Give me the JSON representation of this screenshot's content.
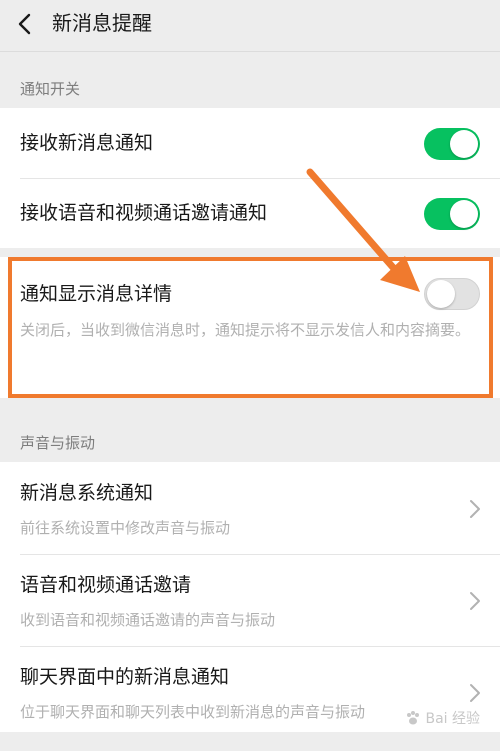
{
  "header": {
    "title": "新消息提醒",
    "back_icon": "chevron-left-icon"
  },
  "sections": {
    "notification_switches": {
      "label": "通知开关",
      "items": [
        {
          "title": "接收新消息通知",
          "toggle": "on"
        },
        {
          "title": "接收语音和视频通话邀请通知",
          "toggle": "on"
        },
        {
          "title": "通知显示消息详情",
          "toggle": "off",
          "description": "关闭后，当收到微信消息时，通知提示将不显示发信人和内容摘要。"
        }
      ]
    },
    "sound_vibration": {
      "label": "声音与振动",
      "items": [
        {
          "title": "新消息系统通知",
          "description": "前往系统设置中修改声音与振动"
        },
        {
          "title": "语音和视频通话邀请",
          "description": "收到语音和视频通话邀请的声音与振动"
        },
        {
          "title": "聊天界面中的新消息通知",
          "description": "位于聊天界面和聊天列表中收到新消息的声音与振动"
        }
      ]
    }
  },
  "watermark": {
    "text": "Bai 经验"
  },
  "colors": {
    "toggle_on": "#07c160",
    "annotation": "#f07a2e",
    "background": "#ededed"
  }
}
